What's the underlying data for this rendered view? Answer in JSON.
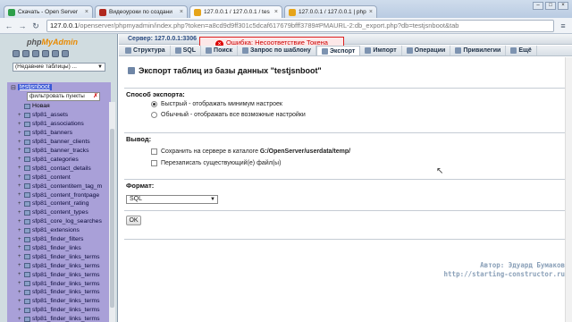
{
  "browser": {
    "tabs": [
      {
        "title": "Скачать - Open Server",
        "icon": "open-server-favicon",
        "color": "#2e9f4a"
      },
      {
        "title": "Видеоуроки по создани",
        "icon": "site-favicon",
        "color": "#b0281f"
      },
      {
        "title": "127.0.0.1 / 127.0.0.1 / tes",
        "icon": "phpmyadmin-favicon",
        "color": "#e6a41a"
      },
      {
        "title": "127.0.0.1 / 127.0.0.1 | php",
        "icon": "phpmyadmin-favicon",
        "color": "#e6a41a"
      }
    ],
    "url_host": "127.0.0.1",
    "url_rest": "/openserver/phpmyadmin/index.php?token=a8cd9d9ff301c5dcaf617679bfff3789#PMAURL-2:db_export.php?db=testjsnboot&tab"
  },
  "left": {
    "logo_prefix": "php",
    "logo_suffix": "MyAdmin",
    "recent_select": "(Недавние таблицы) ...",
    "db_name": "testjsnboot",
    "filter_placeholder": "фильтровать пункты",
    "tables": [
      "Новая",
      "sfp81_assets",
      "sfp81_associations",
      "sfp81_banners",
      "sfp81_banner_clients",
      "sfp81_banner_tracks",
      "sfp81_categories",
      "sfp81_contact_details",
      "sfp81_content",
      "sfp81_contentitem_tag_m",
      "sfp81_content_frontpage",
      "sfp81_content_rating",
      "sfp81_content_types",
      "sfp81_core_log_searches",
      "sfp81_extensions",
      "sfp81_finder_filters",
      "sfp81_finder_links",
      "sfp81_finder_links_terms",
      "sfp81_finder_links_terms",
      "sfp81_finder_links_terms",
      "sfp81_finder_links_terms",
      "sfp81_finder_links_terms",
      "sfp81_finder_links_terms",
      "sfp81_finder_links_terms",
      "sfp81_finder_links_terms",
      "sfp81_finder_links_terms"
    ]
  },
  "main": {
    "server_label": "Сервер: 127.0.0.1:3306",
    "error_text": "Ошибка: Несоответствие Токена",
    "tabs": [
      "Структура",
      "SQL",
      "Поиск",
      "Запрос по шаблону",
      "Экспорт",
      "Импорт",
      "Операции",
      "Привилегии",
      "Ещё"
    ],
    "heading": "Экспорт таблиц из базы данных \"testjsnboot\"",
    "method_legend": "Способ экспорта:",
    "method_quick": "Быстрый - отображать минимум настроек",
    "method_custom": "Обычный - отображать все возможные настройки",
    "output_legend": "Вывод:",
    "save_on_server_prefix": "Сохранить на сервере в каталоге ",
    "save_on_server_path": "G:/OpenServer/userdata/temp/",
    "overwrite": "Перезаписать существующий(е) файл(ы)",
    "format_legend": "Формат:",
    "format_value": "SQL",
    "ok_label": "OK"
  },
  "watermark": {
    "author": "Автор: Эдуард Бумаков",
    "site": "http://starting-constructor.ru"
  }
}
